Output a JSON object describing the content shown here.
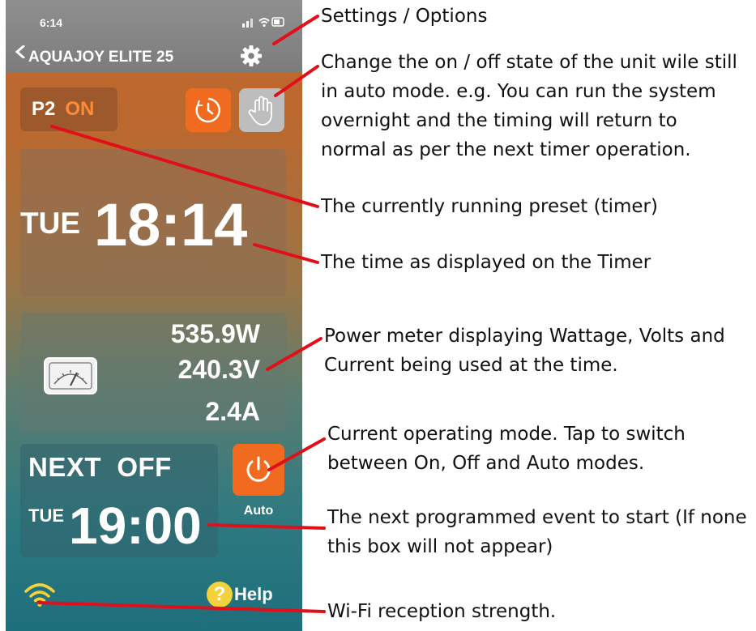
{
  "status_bar": {
    "time": "6:14",
    "icons": "signal wifi battery"
  },
  "header": {
    "title": "AQUAJOY ELITE 25",
    "back_icon": "chevron-left-icon",
    "settings_icon": "gear-icon"
  },
  "preset": {
    "name": "P2",
    "state": "ON"
  },
  "time_display": {
    "day": "TUE",
    "time": "18:14"
  },
  "power_meter": {
    "watts": "535.9W",
    "volts": "240.3V",
    "amps": "2.4A"
  },
  "next_event": {
    "label": "NEXT  OFF",
    "day": "TUE",
    "time": "19:00"
  },
  "mode": {
    "label": "Auto"
  },
  "footer": {
    "help_label": "Help",
    "help_icon": "?"
  },
  "annotations": {
    "settings": "Settings / Options",
    "onoff_1": "Change the on / off state of the unit wile still",
    "onoff_2": "in auto mode. e.g. You can run the system",
    "onoff_3": "overnight and the timing will return to",
    "onoff_4": "normal as per the next timer operation.",
    "preset": "The currently running preset (timer)",
    "time": "The time as displayed on the Timer",
    "power_1": "Power meter displaying Wattage, Volts and",
    "power_2": "Current being used at the time.",
    "mode_1": "Current operating mode. Tap to switch",
    "mode_2": "between On, Off and Auto modes.",
    "next_1": "The next programmed event to start (If none",
    "next_2": "this box will not appear)",
    "wifi": "Wi-Fi reception strength."
  },
  "colors": {
    "accent": "#f06a1f",
    "arrow": "#e0101a",
    "preset_on": "#ff8a3a"
  }
}
